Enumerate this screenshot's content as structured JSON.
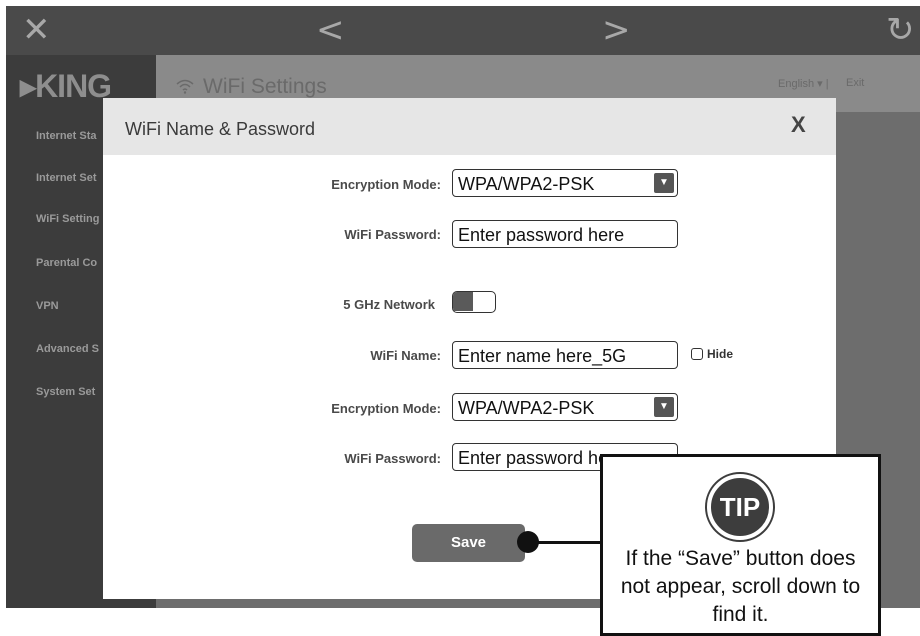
{
  "topbar": {
    "close_icon": "✕",
    "back_icon": "<",
    "forward_icon": ">",
    "refresh_icon": "↻"
  },
  "app": {
    "logo": "▸KING",
    "sidebar_items": [
      "Internet Sta",
      "Internet Set",
      "WiFi Setting",
      "Parental Co",
      "VPN",
      "Advanced S",
      "System Set"
    ],
    "header": {
      "wifi_icon": "wifi-icon",
      "title": "WiFi Settings",
      "language": "English ▾  |",
      "exit": "Exit"
    }
  },
  "modal": {
    "title": "WiFi Name & Password",
    "close": "X",
    "fields": {
      "enc_mode_1_label": "Encryption Mode:",
      "enc_mode_1_value": "WPA/WPA2-PSK",
      "password_1_label": "WiFi Password:",
      "password_1_placeholder": "Enter password here",
      "network_5ghz_label": "5 GHz Network",
      "wifi_name_label": "WiFi Name:",
      "wifi_name_placeholder": "Enter name here_5G",
      "hide_label": "Hide",
      "enc_mode_2_label": "Encryption Mode:",
      "enc_mode_2_value": "WPA/WPA2-PSK",
      "password_2_label": "WiFi Password:",
      "password_2_placeholder": "Enter password here"
    },
    "save_label": "Save"
  },
  "tip": {
    "badge": "TIP",
    "text": "If the “Save” button does not appear, scroll down to find it."
  },
  "colors": {
    "topbar": "#4a4a4a",
    "sidebar": "#3c3c3c",
    "overlay": "#6d6d6d",
    "save_button": "#6a6a6a"
  }
}
